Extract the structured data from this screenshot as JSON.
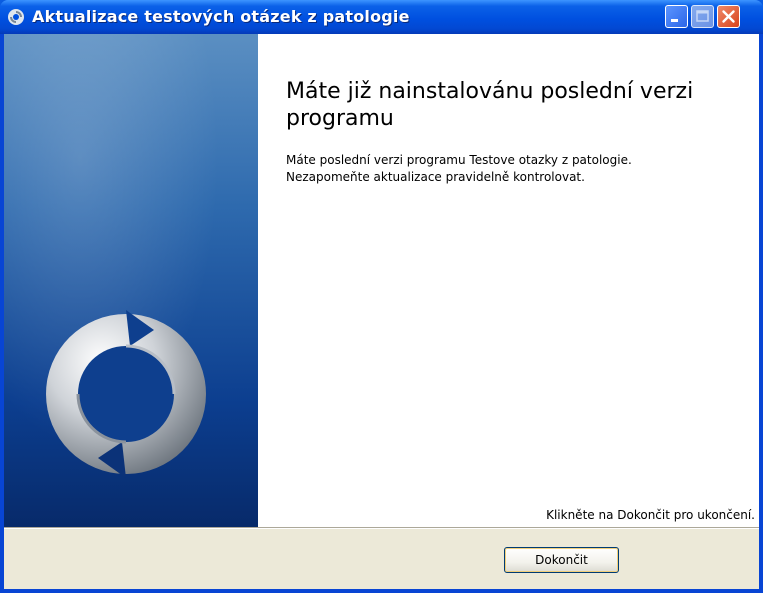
{
  "window": {
    "title": "Aktualizace testových otázek z patologie",
    "buttons": {
      "minimize": "minimize-icon",
      "maximize": "maximize-icon",
      "close": "close-icon"
    }
  },
  "page": {
    "heading": "Máte již nainstalovánu poslední verzi programu",
    "description_lines": [
      "Máte poslední verzi programu Testove otazky z patologie.",
      "Nezapomeňte aktualizace pravidelně kontrolovat."
    ],
    "finish_hint": "Klikněte na Dokončit pro ukončení."
  },
  "footer": {
    "finish_label": "Dokončit"
  },
  "icons": {
    "window_icon": "update-arrows-icon",
    "sidebar_logo": "update-arrows-icon"
  },
  "colors": {
    "titlebar": "#0050e0",
    "sidebar": "#0c3e8f",
    "content_bg": "#ffffff",
    "footer_bg": "#ece9d8"
  }
}
